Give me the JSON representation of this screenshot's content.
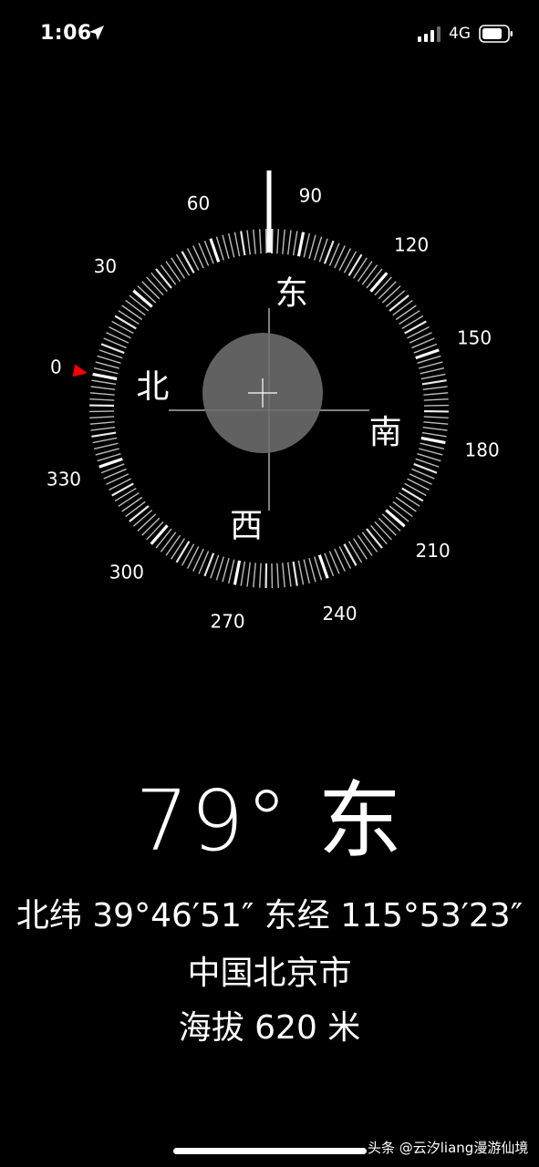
{
  "status_bar": {
    "time": "1:06",
    "network": "4G"
  },
  "compass": {
    "degree_labels": [
      "0",
      "30",
      "60",
      "90",
      "120",
      "150",
      "180",
      "210",
      "240",
      "270",
      "300",
      "330"
    ],
    "cardinals": {
      "north": "北",
      "east": "东",
      "south": "南",
      "west": "西"
    },
    "accent_color": "#ff0000"
  },
  "reading": {
    "heading": "79° 东",
    "coordinates": "北纬 39°46′51″  东经 115°53′23″",
    "city": "中国北京市",
    "altitude": "海拔 620 米"
  },
  "watermark": "头条 @云汐liang漫游仙境"
}
